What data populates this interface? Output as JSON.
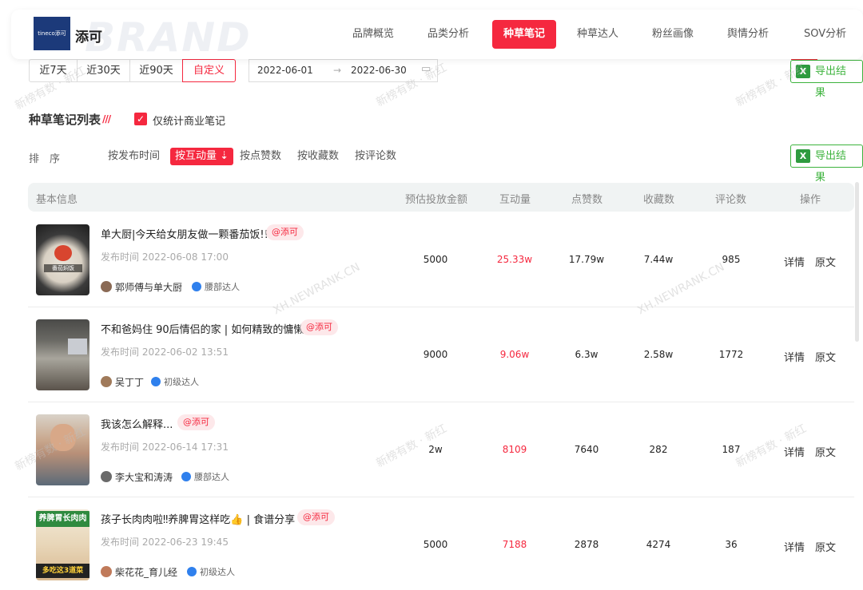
{
  "brand": {
    "logo_text": "tineco添可",
    "name": "添可",
    "watermark": "BRAND"
  },
  "nav": {
    "items": [
      "品牌概览",
      "品类分析",
      "种草笔记",
      "种草达人",
      "粉丝画像",
      "舆情分析",
      "SOV分析"
    ],
    "active": "种草笔记"
  },
  "date_filter": {
    "options": [
      "近7天",
      "近30天",
      "近90天",
      "自定义"
    ],
    "active": "自定义",
    "start": "2022-06-01",
    "separator": "→",
    "end": "2022-06-30"
  },
  "export_label": "导出结果",
  "section": {
    "title": "种草笔记列表",
    "checkbox_label": "仅统计商业笔记",
    "checked": true
  },
  "sort": {
    "label": "排　序",
    "options": [
      "按发布时间",
      "按互动量",
      "按点赞数",
      "按收藏数",
      "按评论数"
    ],
    "active": "按互动量"
  },
  "table": {
    "headers": [
      "基本信息",
      "预估投放金额",
      "互动量",
      "点赞数",
      "收藏数",
      "评论数",
      "操作"
    ],
    "actions": [
      "详情",
      "原文"
    ],
    "rows": [
      {
        "title": "单大厨|今天给女朋友做一颗番茄饭!!",
        "tag": "@添可",
        "published": "发布时间 2022-06-08 17:00",
        "author": "郭师傅与单大厨",
        "level": "腰部达人",
        "amount": "5000",
        "interactions": "25.33w",
        "likes": "17.79w",
        "favorites": "7.44w",
        "comments": "985"
      },
      {
        "title": "不和爸妈住 90后情侣的家 | 如何精致的慵懒",
        "tag": "@添可",
        "published": "发布时间 2022-06-02 13:51",
        "author": "吴丁丁",
        "level": "初级达人",
        "amount": "9000",
        "interactions": "9.06w",
        "likes": "6.3w",
        "favorites": "2.58w",
        "comments": "1772"
      },
      {
        "title": "我该怎么解释...",
        "tag": "@添可",
        "published": "发布时间 2022-06-14 17:31",
        "author": "李大宝和涛涛",
        "level": "腰部达人",
        "amount": "2w",
        "interactions": "8109",
        "likes": "7640",
        "favorites": "282",
        "comments": "187"
      },
      {
        "title": "孩子长肉肉啦‼养脾胃这样吃👍 | 食谱分享",
        "tag": "@添可",
        "published": "发布时间 2022-06-23 19:45",
        "author": "柴花花_育儿经",
        "level": "初级达人",
        "amount": "5000",
        "interactions": "7188",
        "likes": "2878",
        "favorites": "4274",
        "comments": "36"
      }
    ]
  },
  "thumb_text": {
    "row1": "番茄焖饭",
    "row4_top": "养脾胃长肉肉",
    "row4_bottom": "多吃这3道菜"
  },
  "watermarks": [
    "新榜有数 · 新红",
    "XH.NEWRANK.CN"
  ],
  "colors": {
    "accent": "#f5283f",
    "export_green": "#3db33d",
    "level_blue": "#2f80ed"
  }
}
